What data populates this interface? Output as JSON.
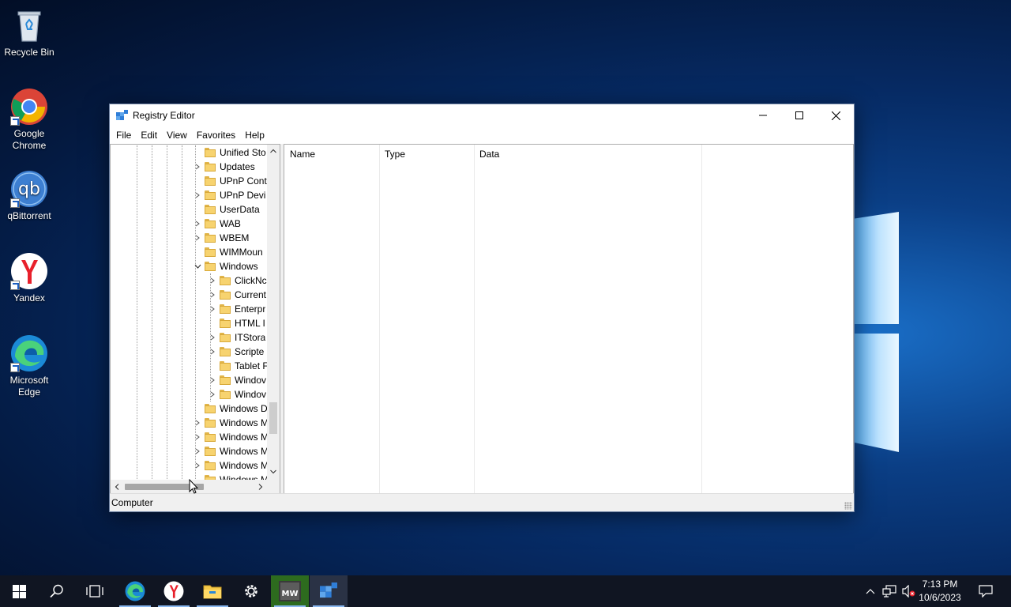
{
  "desktop": {
    "icons": [
      {
        "label": "Recycle Bin",
        "icon": "recycle-bin-icon"
      },
      {
        "label": "Google Chrome",
        "icon": "chrome-icon"
      },
      {
        "label": "qBittorrent",
        "icon": "qbittorrent-icon"
      },
      {
        "label": "Yandex",
        "icon": "yandex-icon"
      },
      {
        "label": "Microsoft Edge",
        "icon": "edge-icon"
      }
    ]
  },
  "window": {
    "title": "Registry Editor",
    "menu": [
      "File",
      "Edit",
      "View",
      "Favorites",
      "Help"
    ],
    "tree": [
      {
        "label": "Unified Sto",
        "expandable": false
      },
      {
        "label": "Updates",
        "expandable": true
      },
      {
        "label": "UPnP Cont",
        "expandable": false
      },
      {
        "label": "UPnP Devi",
        "expandable": true
      },
      {
        "label": "UserData",
        "expandable": false
      },
      {
        "label": "WAB",
        "expandable": true
      },
      {
        "label": "WBEM",
        "expandable": true
      },
      {
        "label": "WIMMoun",
        "expandable": false
      },
      {
        "label": "Windows",
        "expandable": true,
        "expanded": true
      },
      {
        "label": "ClickNc",
        "expandable": true
      },
      {
        "label": "Current",
        "expandable": true
      },
      {
        "label": "Enterpr",
        "expandable": true
      },
      {
        "label": "HTML I",
        "expandable": false
      },
      {
        "label": "ITStora",
        "expandable": true
      },
      {
        "label": "Scripte",
        "expandable": true
      },
      {
        "label": "Tablet F",
        "expandable": false
      },
      {
        "label": "Windov",
        "expandable": true
      },
      {
        "label": "Windov",
        "expandable": true
      },
      {
        "label": "Windows D",
        "expandable": false
      },
      {
        "label": "Windows M",
        "expandable": true
      },
      {
        "label": "Windows M",
        "expandable": true
      },
      {
        "label": "Windows M",
        "expandable": true
      },
      {
        "label": "Windows M",
        "expandable": true
      },
      {
        "label": "Windows M",
        "expandable": false
      }
    ],
    "columns": {
      "name": "Name",
      "type": "Type",
      "data": "Data"
    },
    "status": "Computer"
  },
  "taskbar": {
    "time": "7:13 PM",
    "date": "10/6/2023"
  },
  "colors": {
    "accent": "#0078d7",
    "taskbar": "#101522"
  }
}
